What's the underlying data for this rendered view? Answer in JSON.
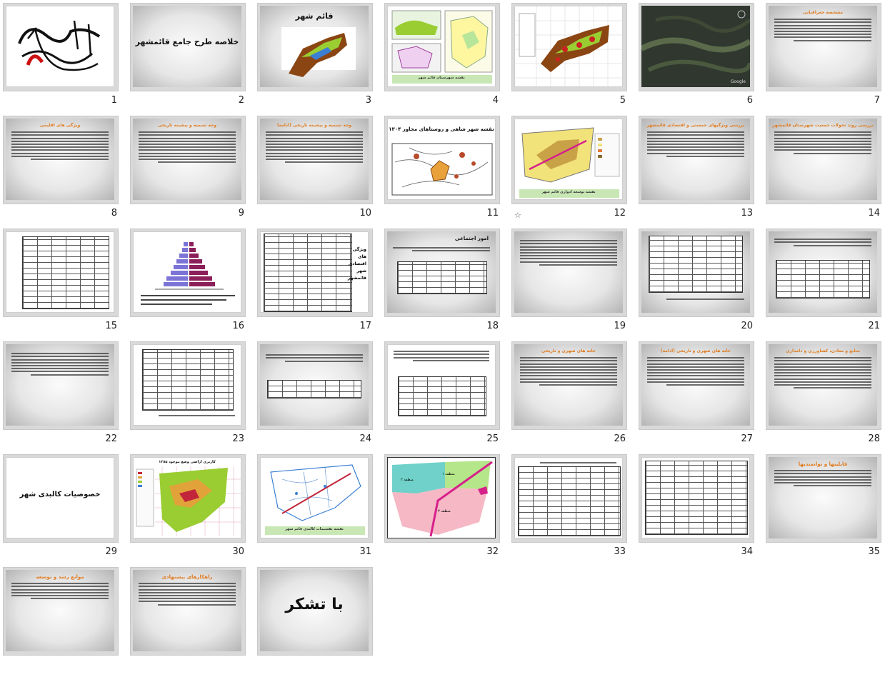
{
  "slides": [
    {
      "num": "1",
      "title": ""
    },
    {
      "num": "2",
      "title": "خلاصه طرح جامع قائمشهر"
    },
    {
      "num": "3",
      "title": "قائم شهر"
    },
    {
      "num": "4",
      "title": "نقشه شهرستان قائم شهر"
    },
    {
      "num": "5",
      "title": ""
    },
    {
      "num": "6",
      "title": "Google"
    },
    {
      "num": "7",
      "title": "مشخصه جغرافیایی"
    },
    {
      "num": "8",
      "title": "ویژگی های اقلیمی"
    },
    {
      "num": "9",
      "title": "وجه تسمیه و پیشینه تاریخی"
    },
    {
      "num": "10",
      "title": "وجه تسمیه و پیشینه تاریخی (ادامه)"
    },
    {
      "num": "11",
      "title": "نقشه شهر شاهی و روستاهای مجاور ۱۳۰۴"
    },
    {
      "num": "12",
      "title": "نقشه توسعه ادواری قائم شهر"
    },
    {
      "num": "13",
      "title": "بررسی ویژگیهای جمعیتی و اقتصادی قائمشهر"
    },
    {
      "num": "14",
      "title": "بررسی روند تحولات جمعیت شهرستان قائمشهر"
    },
    {
      "num": "15",
      "title": ""
    },
    {
      "num": "16",
      "title": ""
    },
    {
      "num": "17",
      "title": "ویژگی های اقتصادی شهر قائمشهر"
    },
    {
      "num": "18",
      "title": "امور اجتماعی"
    },
    {
      "num": "19",
      "title": ""
    },
    {
      "num": "20",
      "title": ""
    },
    {
      "num": "21",
      "title": ""
    },
    {
      "num": "22",
      "title": ""
    },
    {
      "num": "23",
      "title": ""
    },
    {
      "num": "24",
      "title": ""
    },
    {
      "num": "25",
      "title": ""
    },
    {
      "num": "26",
      "title": "خانه های شهری و تاریخی"
    },
    {
      "num": "27",
      "title": "خانه های شهری و تاریخی (ادامه)"
    },
    {
      "num": "28",
      "title": "منابع و معادن، کشاورزی و دامداری"
    },
    {
      "num": "29",
      "title": "خصوصیات کالبدی شهر"
    },
    {
      "num": "30",
      "title": "کاربری اراضی وضع موجود ۱۳۸۵"
    },
    {
      "num": "31",
      "title": "نقشه تقسیمات کالبدی قائم شهر"
    },
    {
      "num": "32",
      "title": ""
    },
    {
      "num": "33",
      "title": ""
    },
    {
      "num": "34",
      "title": ""
    },
    {
      "num": "35",
      "title": "قابلیتها و توانمندیها"
    },
    {
      "num": "36",
      "title": "موانع رشد و توسعه"
    },
    {
      "num": "37",
      "title": "راهکارهای پیشنهادی"
    },
    {
      "num": "38",
      "title": "با تشکر"
    }
  ],
  "labels": {
    "region1": "منطقه ۱",
    "region2": "منطقه ۲",
    "region3": "منطقه ۳",
    "province": "مازندران",
    "country": "ایران"
  },
  "colors": {
    "orange_title": "#e07b1f",
    "map_green": "#9acd32",
    "map_brown": "#8b4513",
    "region_pink": "#f5b8c4",
    "region_teal": "#6fd1c9",
    "region_green": "#b5e68a",
    "river_magenta": "#d6208a"
  }
}
